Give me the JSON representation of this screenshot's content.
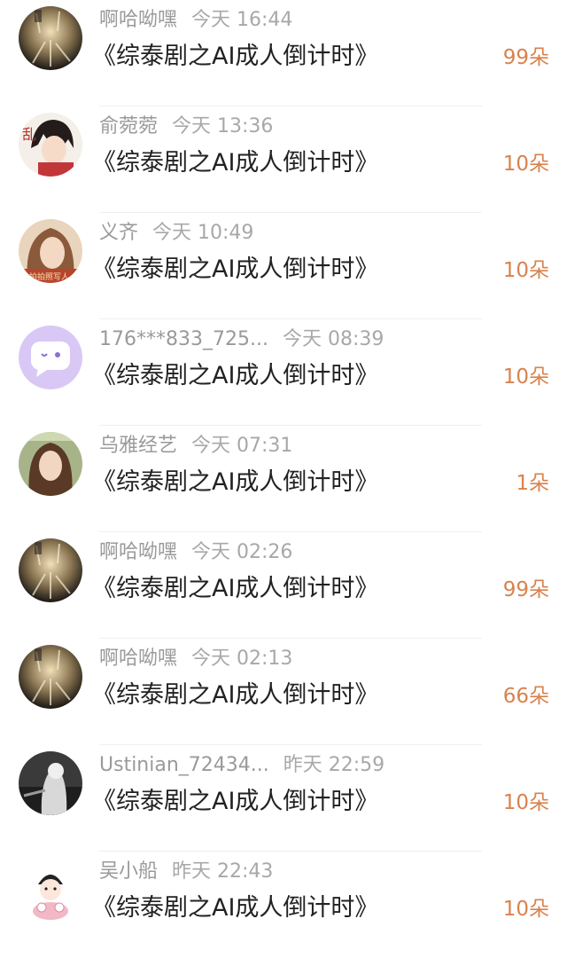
{
  "colors": {
    "username": "#9a9a9a",
    "time": "#a8a8a8",
    "title": "#222222",
    "gift": "#d9824d",
    "divider": "#efefef"
  },
  "records": [
    {
      "user": "啊哈呦嘿",
      "time": "今天 16:44",
      "title": "《综泰剧之AI成人倒计时》",
      "gift": "99朵",
      "avatar": "avatar-dark-icon"
    },
    {
      "user": "俞菀菀",
      "time": "今天 13:36",
      "title": "《综泰剧之AI成人倒计时》",
      "gift": "10朵",
      "avatar": "avatar-anime-boy-icon"
    },
    {
      "user": "义齐",
      "time": "今天 10:49",
      "title": "《综泰剧之AI成人倒计时》",
      "gift": "10朵",
      "avatar": "avatar-girl-brown-hair-icon"
    },
    {
      "user": "176***833_725...",
      "time": "今天 08:39",
      "title": "《综泰剧之AI成人倒计时》",
      "gift": "10朵",
      "avatar": "avatar-default-chat-icon"
    },
    {
      "user": "乌雅经艺",
      "time": "今天 07:31",
      "title": "《综泰剧之AI成人倒计时》",
      "gift": "1朵",
      "avatar": "avatar-girl-outdoor-icon"
    },
    {
      "user": "啊哈呦嘿",
      "time": "今天 02:26",
      "title": "《综泰剧之AI成人倒计时》",
      "gift": "99朵",
      "avatar": "avatar-dark-icon"
    },
    {
      "user": "啊哈呦嘿",
      "time": "今天 02:13",
      "title": "《综泰剧之AI成人倒计时》",
      "gift": "66朵",
      "avatar": "avatar-dark-icon"
    },
    {
      "user": "Ustinian_72434...",
      "time": "昨天 22:59",
      "title": "《综泰剧之AI成人倒计时》",
      "gift": "10朵",
      "avatar": "avatar-grayscale-icon"
    },
    {
      "user": "吴小船",
      "time": "昨天 22:43",
      "title": "《综泰剧之AI成人倒计时》",
      "gift": "10朵",
      "avatar": "avatar-cartoon-icon"
    }
  ]
}
